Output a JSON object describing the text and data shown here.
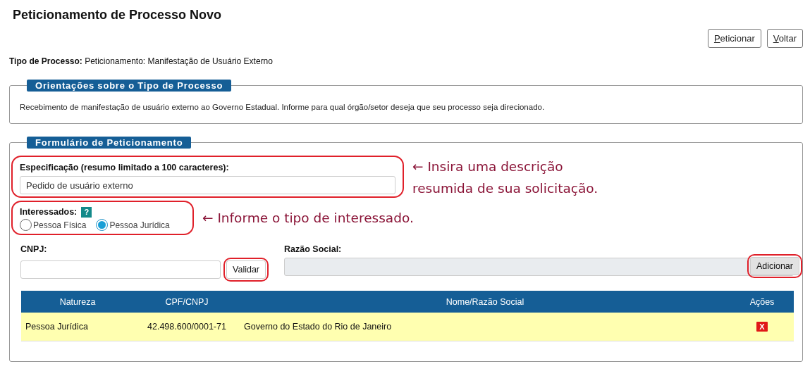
{
  "title": "Peticionamento de Processo Novo",
  "actions": [
    {
      "label": "Peticionar"
    },
    {
      "label": "Voltar"
    }
  ],
  "process_type": {
    "label": "Tipo de Processo:",
    "value": "Peticionamento: Manifestação de Usuário Externo"
  },
  "guidance": {
    "legend": "Orientações sobre o Tipo de Processo",
    "text": "Recebimento de manifestação de usuário externo ao Governo Estadual. Informe para qual órgão/setor deseja que seu processo seja direcionado."
  },
  "form": {
    "legend": "Formulário de Peticionamento",
    "specification": {
      "label": "Especificação (resumo limitado a 100 caracteres):",
      "value": "Pedido de usuário externo",
      "annotation": "← Insira uma descrição resumida de sua solicitação."
    },
    "interested": {
      "label": "Interessados:",
      "help": "?",
      "annotation": "← Informe o tipo de interessado.",
      "options": [
        {
          "label": "Pessoa Física",
          "selected": false
        },
        {
          "label": "Pessoa Jurídica",
          "selected": true
        }
      ]
    },
    "cnpj": {
      "label": "CNPJ:",
      "button": "Validar"
    },
    "company_name": {
      "label": "Razão Social:",
      "button": "Adicionar"
    },
    "table": {
      "columns": [
        "Natureza",
        "CPF/CNPJ",
        "Nome/Razão Social",
        "Ações"
      ],
      "rows": [
        {
          "cells": [
            "Pessoa Jurídica",
            "42.498.600/0001-71",
            "Governo do Estado do Rio de Janeiro"
          ],
          "action": "X"
        }
      ]
    }
  }
}
